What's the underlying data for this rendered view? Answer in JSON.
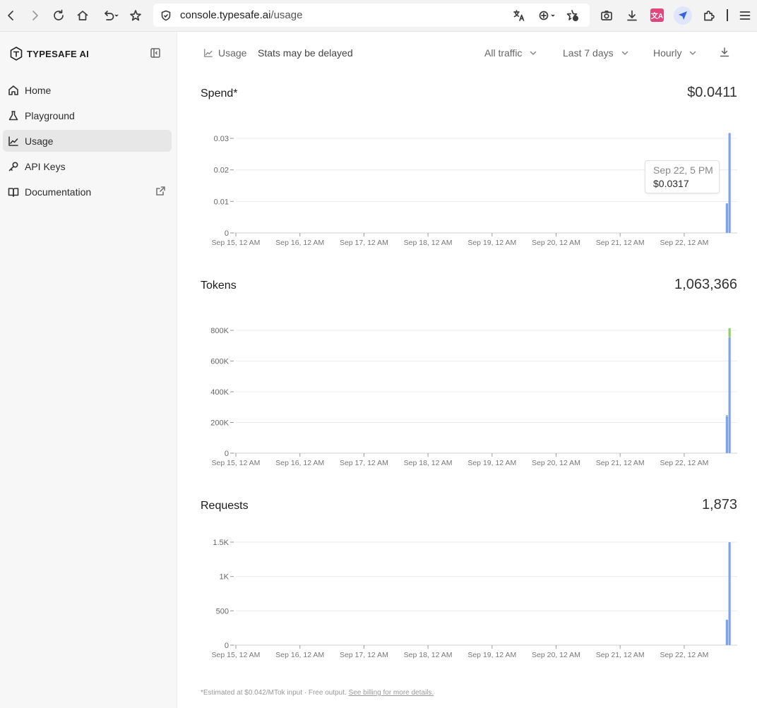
{
  "browser": {
    "url_host": "console.typesafe.ai",
    "url_path": "/usage"
  },
  "sidebar": {
    "brand": "TYPESAFE AI",
    "items": [
      {
        "label": "Home",
        "icon": "home-icon"
      },
      {
        "label": "Playground",
        "icon": "flask-icon"
      },
      {
        "label": "Usage",
        "icon": "chart-line-icon",
        "active": true
      },
      {
        "label": "API Keys",
        "icon": "key-icon"
      },
      {
        "label": "Documentation",
        "icon": "book-icon"
      }
    ]
  },
  "header": {
    "section": "Usage",
    "note": "Stats may be delayed",
    "traffic_filter": "All traffic",
    "range_filter": "Last 7 days",
    "granularity": "Hourly"
  },
  "colors": {
    "input": "#7da2f2",
    "output": "#8ccf6a",
    "grid": "#ececec"
  },
  "panels": {
    "spend": {
      "title": "Spend*",
      "total": "$0.0411"
    },
    "tokens": {
      "title": "Tokens",
      "total": "1,063,366"
    },
    "requests": {
      "title": "Requests",
      "total": "1,873"
    }
  },
  "tooltip": {
    "time": "Sep 22, 5 PM",
    "value": "$0.0317"
  },
  "footnote": {
    "text": "*Estimated at $0.042/MTok input · Free output. ",
    "link": "See billing for more details."
  },
  "chart_data": [
    {
      "type": "bar",
      "name": "spend",
      "x_categories": [
        "Sep 15, 12 AM",
        "Sep 16, 12 AM",
        "Sep 17, 12 AM",
        "Sep 18, 12 AM",
        "Sep 19, 12 AM",
        "Sep 20, 12 AM",
        "Sep 21, 12 AM",
        "Sep 22, 12 AM"
      ],
      "y_ticks": [
        "0",
        "0.01",
        "0.02",
        "0.03"
      ],
      "ylim": [
        0,
        0.03
      ],
      "bars": [
        {
          "x": "Sep 22, 4 PM",
          "input": 0.0094,
          "output": 0
        },
        {
          "x": "Sep 22, 5 PM",
          "input": 0.0317,
          "output": 0
        }
      ]
    },
    {
      "type": "bar",
      "name": "tokens",
      "x_categories": [
        "Sep 15, 12 AM",
        "Sep 16, 12 AM",
        "Sep 17, 12 AM",
        "Sep 18, 12 AM",
        "Sep 19, 12 AM",
        "Sep 20, 12 AM",
        "Sep 21, 12 AM",
        "Sep 22, 12 AM"
      ],
      "y_ticks": [
        "0",
        "200K",
        "400K",
        "600K",
        "800K"
      ],
      "ylim": [
        0,
        800000
      ],
      "bars": [
        {
          "x": "Sep 22, 4 PM",
          "input": 240000,
          "output": 8000
        },
        {
          "x": "Sep 22, 5 PM",
          "input": 755000,
          "output": 60000
        }
      ]
    },
    {
      "type": "bar",
      "name": "requests",
      "x_categories": [
        "Sep 15, 12 AM",
        "Sep 16, 12 AM",
        "Sep 17, 12 AM",
        "Sep 18, 12 AM",
        "Sep 19, 12 AM",
        "Sep 20, 12 AM",
        "Sep 21, 12 AM",
        "Sep 22, 12 AM"
      ],
      "y_ticks": [
        "0",
        "500",
        "1K",
        "1.5K"
      ],
      "ylim": [
        0,
        1500
      ],
      "bars": [
        {
          "x": "Sep 22, 4 PM",
          "input": 373,
          "output": 0
        },
        {
          "x": "Sep 22, 5 PM",
          "input": 1500,
          "output": 0
        }
      ]
    }
  ]
}
